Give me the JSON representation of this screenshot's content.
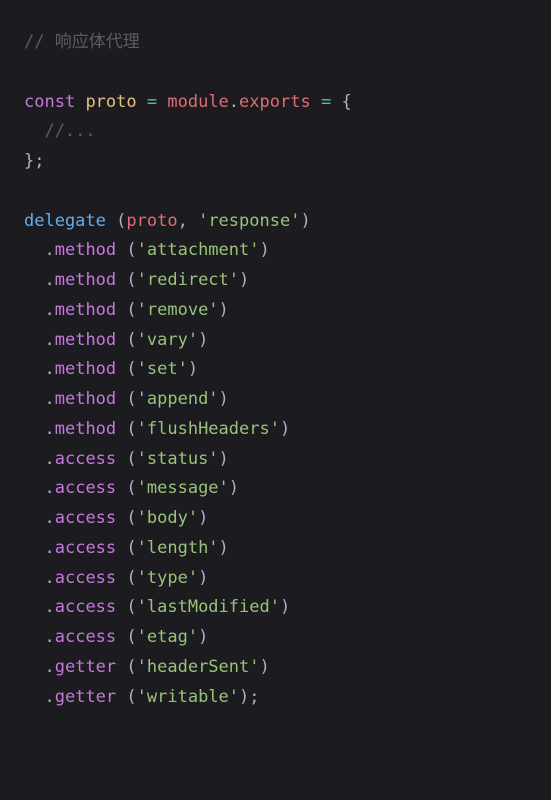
{
  "code": {
    "comment1": "// 响应体代理",
    "const_kw": "const",
    "proto_var": "proto",
    "eq1": "=",
    "module_ident": "module",
    "dot1": ".",
    "exports_prop": "exports",
    "eq2": "=",
    "brace_open": "{",
    "comment2": "//...",
    "brace_close": "}",
    "semi1": ";",
    "delegate_fn": "delegate",
    "sp": " ",
    "paren_open": "(",
    "proto_arg": "proto",
    "comma": ",",
    "response_str": "'response'",
    "paren_close": ")",
    "chains": [
      {
        "method": "method",
        "arg": "'attachment'"
      },
      {
        "method": "method",
        "arg": "'redirect'"
      },
      {
        "method": "method",
        "arg": "'remove'"
      },
      {
        "method": "method",
        "arg": "'vary'"
      },
      {
        "method": "method",
        "arg": "'set'"
      },
      {
        "method": "method",
        "arg": "'append'"
      },
      {
        "method": "method",
        "arg": "'flushHeaders'"
      },
      {
        "method": "access",
        "arg": "'status'"
      },
      {
        "method": "access",
        "arg": "'message'"
      },
      {
        "method": "access",
        "arg": "'body'"
      },
      {
        "method": "access",
        "arg": "'length'"
      },
      {
        "method": "access",
        "arg": "'type'"
      },
      {
        "method": "access",
        "arg": "'lastModified'"
      },
      {
        "method": "access",
        "arg": "'etag'"
      },
      {
        "method": "getter",
        "arg": "'headerSent'"
      },
      {
        "method": "getter",
        "arg": "'writable'"
      }
    ],
    "final_semi": ";"
  }
}
